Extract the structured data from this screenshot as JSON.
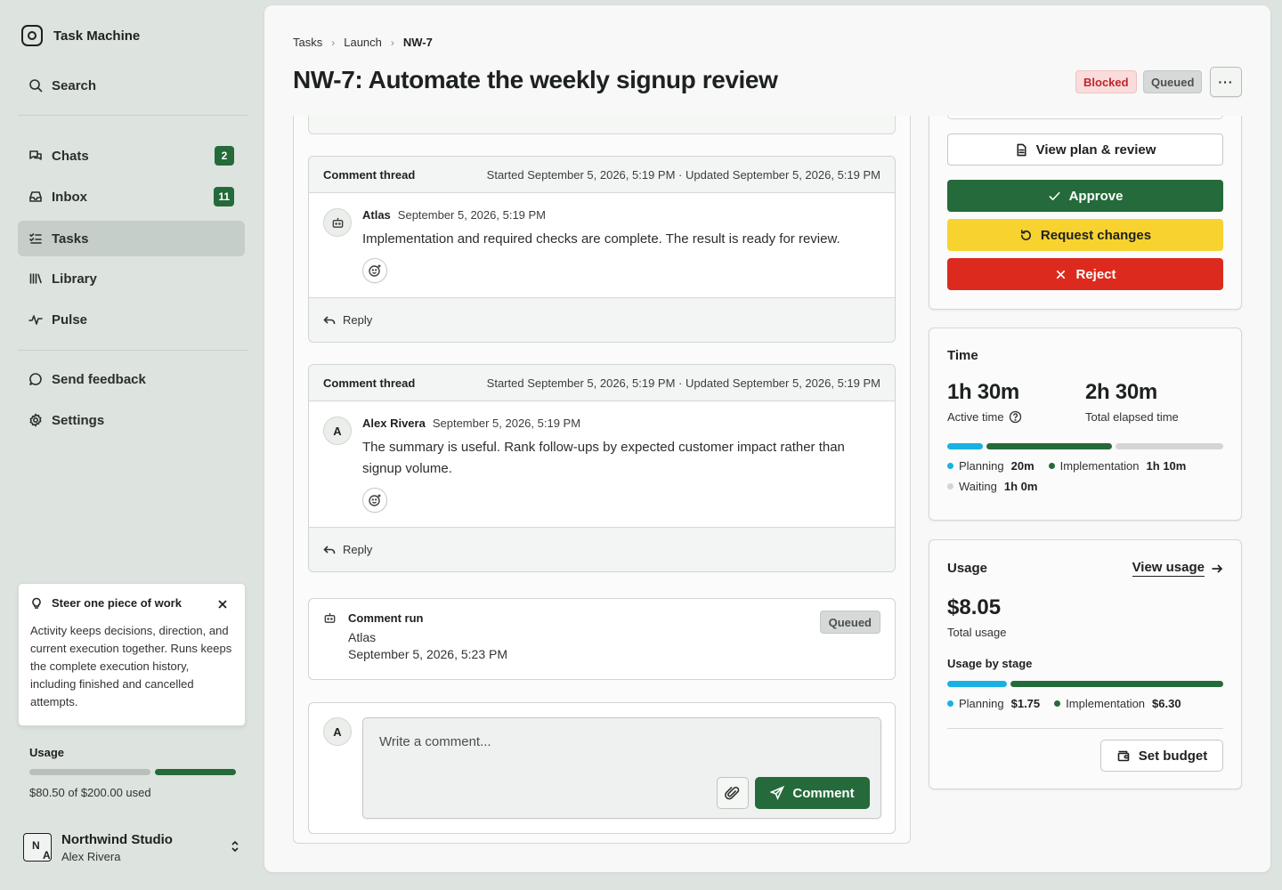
{
  "app": {
    "name": "Task Machine"
  },
  "sidebar": {
    "search_label": "Search",
    "items": [
      {
        "label": "Chats",
        "badge": "2",
        "icon": "chats-icon"
      },
      {
        "label": "Inbox",
        "badge": "11",
        "icon": "inbox-icon"
      },
      {
        "label": "Tasks",
        "badge": "",
        "icon": "tasks-icon",
        "active": true
      },
      {
        "label": "Library",
        "badge": "",
        "icon": "library-icon"
      },
      {
        "label": "Pulse",
        "badge": "",
        "icon": "pulse-icon"
      }
    ],
    "feedback_label": "Send feedback",
    "settings_label": "Settings",
    "steer": {
      "title": "Steer one piece of work",
      "body": "Activity keeps decisions, direction, and current execution together. Runs keeps the complete execution history, including finished and cancelled attempts."
    },
    "usage": {
      "title": "Usage",
      "used_text": "$80.50 of $200.00 used",
      "used": 80.5,
      "limit": 200
    },
    "workspace": {
      "name": "Northwind Studio",
      "user": "Alex Rivera",
      "avatar_initials_top": "N",
      "avatar_initials_bottom": "A"
    }
  },
  "breadcrumb": {
    "items": [
      "Tasks",
      "Launch"
    ],
    "current": "NW-7"
  },
  "task": {
    "title": "NW-7: Automate the weekly signup review",
    "status_blocked": "Blocked",
    "status_queued": "Queued",
    "more_label": "···"
  },
  "threads": [
    {
      "title": "Comment thread",
      "started": "Started September 5, 2026, 5:19 PM",
      "separator": "·",
      "updated": "Updated September 5, 2026, 5:19 PM",
      "author": "Atlas",
      "author_type": "agent",
      "time": "September 5, 2026, 5:19 PM",
      "text": "Implementation and required checks are complete. The result is ready for review.",
      "reply_label": "Reply"
    },
    {
      "title": "Comment thread",
      "started": "Started September 5, 2026, 5:19 PM",
      "separator": "·",
      "updated": "Updated September 5, 2026, 5:19 PM",
      "author": "Alex Rivera",
      "author_initial": "A",
      "time": "September 5, 2026, 5:19 PM",
      "text": "The summary is useful. Rank follow-ups by expected customer impact rather than signup volume.",
      "reply_label": "Reply"
    }
  ],
  "comment_run": {
    "title": "Comment run",
    "agent": "Atlas",
    "time": "September 5, 2026, 5:23 PM",
    "status": "Queued"
  },
  "composer": {
    "avatar_initial": "A",
    "placeholder": "Write a comment...",
    "submit_label": "Comment"
  },
  "actions": {
    "view_plan": "View plan & review",
    "approve": "Approve",
    "request_changes": "Request changes",
    "reject": "Reject"
  },
  "time_card": {
    "title": "Time",
    "active_value": "1h 30m",
    "active_label": "Active time",
    "total_value": "2h 30m",
    "total_label": "Total elapsed time",
    "stages": [
      {
        "name": "Planning",
        "value": "20m",
        "minutes": 20,
        "color": "#19b1e3"
      },
      {
        "name": "Implementation",
        "value": "1h 10m",
        "minutes": 70,
        "color": "#256a3a"
      },
      {
        "name": "Waiting",
        "value": "1h 0m",
        "minutes": 60,
        "color": "#d3d6d4"
      }
    ]
  },
  "usage_card": {
    "title": "Usage",
    "link_label": "View usage",
    "amount": "$8.05",
    "amount_label": "Total usage",
    "stage_title": "Usage by stage",
    "stages": [
      {
        "name": "Planning",
        "value": "$1.75",
        "amount": 1.75,
        "color": "#19b1e3"
      },
      {
        "name": "Implementation",
        "value": "$6.30",
        "amount": 6.3,
        "color": "#256a3a"
      }
    ],
    "budget_label": "Set budget"
  },
  "colors": {
    "accent_green": "#256a3a",
    "blocked_red": "#c0252b",
    "warn_yellow": "#f8d22f",
    "reject_red": "#dc2a1f",
    "planning_blue": "#19b1e3"
  }
}
